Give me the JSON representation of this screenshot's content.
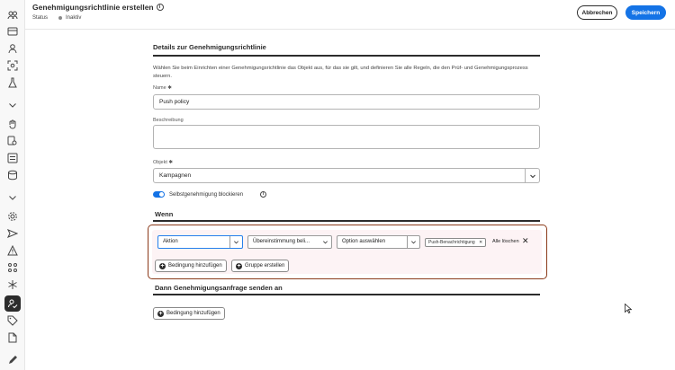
{
  "header": {
    "title": "Genehmigungsrichtlinie erstellen",
    "status_label": "Status",
    "status_value": "Inaktiv",
    "cancel_label": "Abbrechen",
    "save_label": "Speichern"
  },
  "rail": {
    "icons": [
      "people-group-icon",
      "cards-icon",
      "user-icon",
      "target-icon",
      "flask-icon",
      "chevron-down-icon",
      "hand-icon",
      "search-doc-icon",
      "list-icon",
      "database-icon",
      "chevron-down-icon",
      "gear-icon",
      "send-icon",
      "alert-icon",
      "grid-icon",
      "asterisk-icon",
      "user-check-icon",
      "tag-icon",
      "document-icon",
      "pencil-icon"
    ],
    "active": "user-check-icon"
  },
  "details": {
    "section_title": "Details zur Genehmigungsrichtlinie",
    "description": "Wählen Sie beim Einrichten einer Genehmigungsrichtlinie das Objekt aus, für das sie gilt, und definieren Sie alle Regeln, die den Prüf- und Genehmigungsprozess steuern.",
    "name_label": "Name ✱",
    "name_value": "Push policy",
    "beschreibung_label": "Beschreibung",
    "objekt_label": "Objekt ✱",
    "objekt_value": "Kampagnen",
    "toggle_label": "Selbstgenehmigung blockieren",
    "toggle_on": true
  },
  "wenn": {
    "section_title": "Wenn",
    "field_select": "Aktion",
    "operator_select": "Übereinstimmung beli...",
    "option_select": "Option auswählen",
    "tag": "Push-Benachrichtigung",
    "clear_all": "Alle löschen",
    "add_condition": "Bedingung hinzufügen",
    "create_group": "Gruppe erstellen"
  },
  "dann": {
    "section_title": "Dann Genehmigungsanfrage senden an",
    "add_condition": "Bedingung hinzufügen"
  },
  "colors": {
    "accent": "#1473e6",
    "highlight_border": "#8b3a1a",
    "condition_bg": "#fdf3f5"
  }
}
